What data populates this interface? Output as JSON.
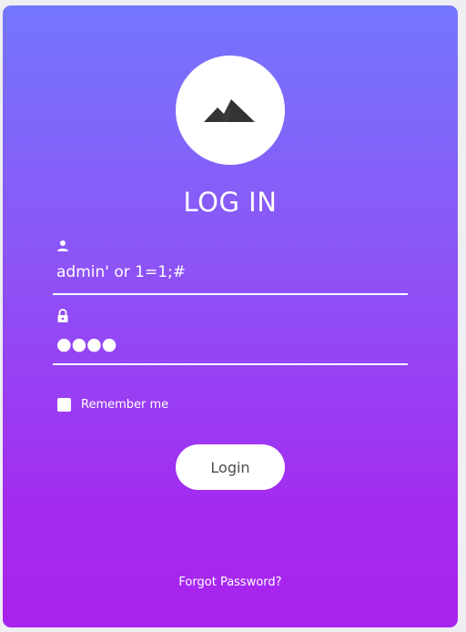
{
  "login_form": {
    "title": "LOG IN",
    "username": {
      "icon": "user-icon",
      "value": "admin' or 1=1;#"
    },
    "password": {
      "icon": "lock-icon",
      "masked_value": "●●●●"
    },
    "remember_label": "Remember me",
    "remember_checked": false,
    "login_button": "Login",
    "forgot_link": "Forgot Password?"
  },
  "logo": {
    "icon": "mountain-icon"
  },
  "colors": {
    "gradient_top": "#7476fd",
    "gradient_bottom": "#a823ee",
    "text": "#ffffff",
    "button_text": "#4b4b4b",
    "logo_icon": "#333333"
  }
}
